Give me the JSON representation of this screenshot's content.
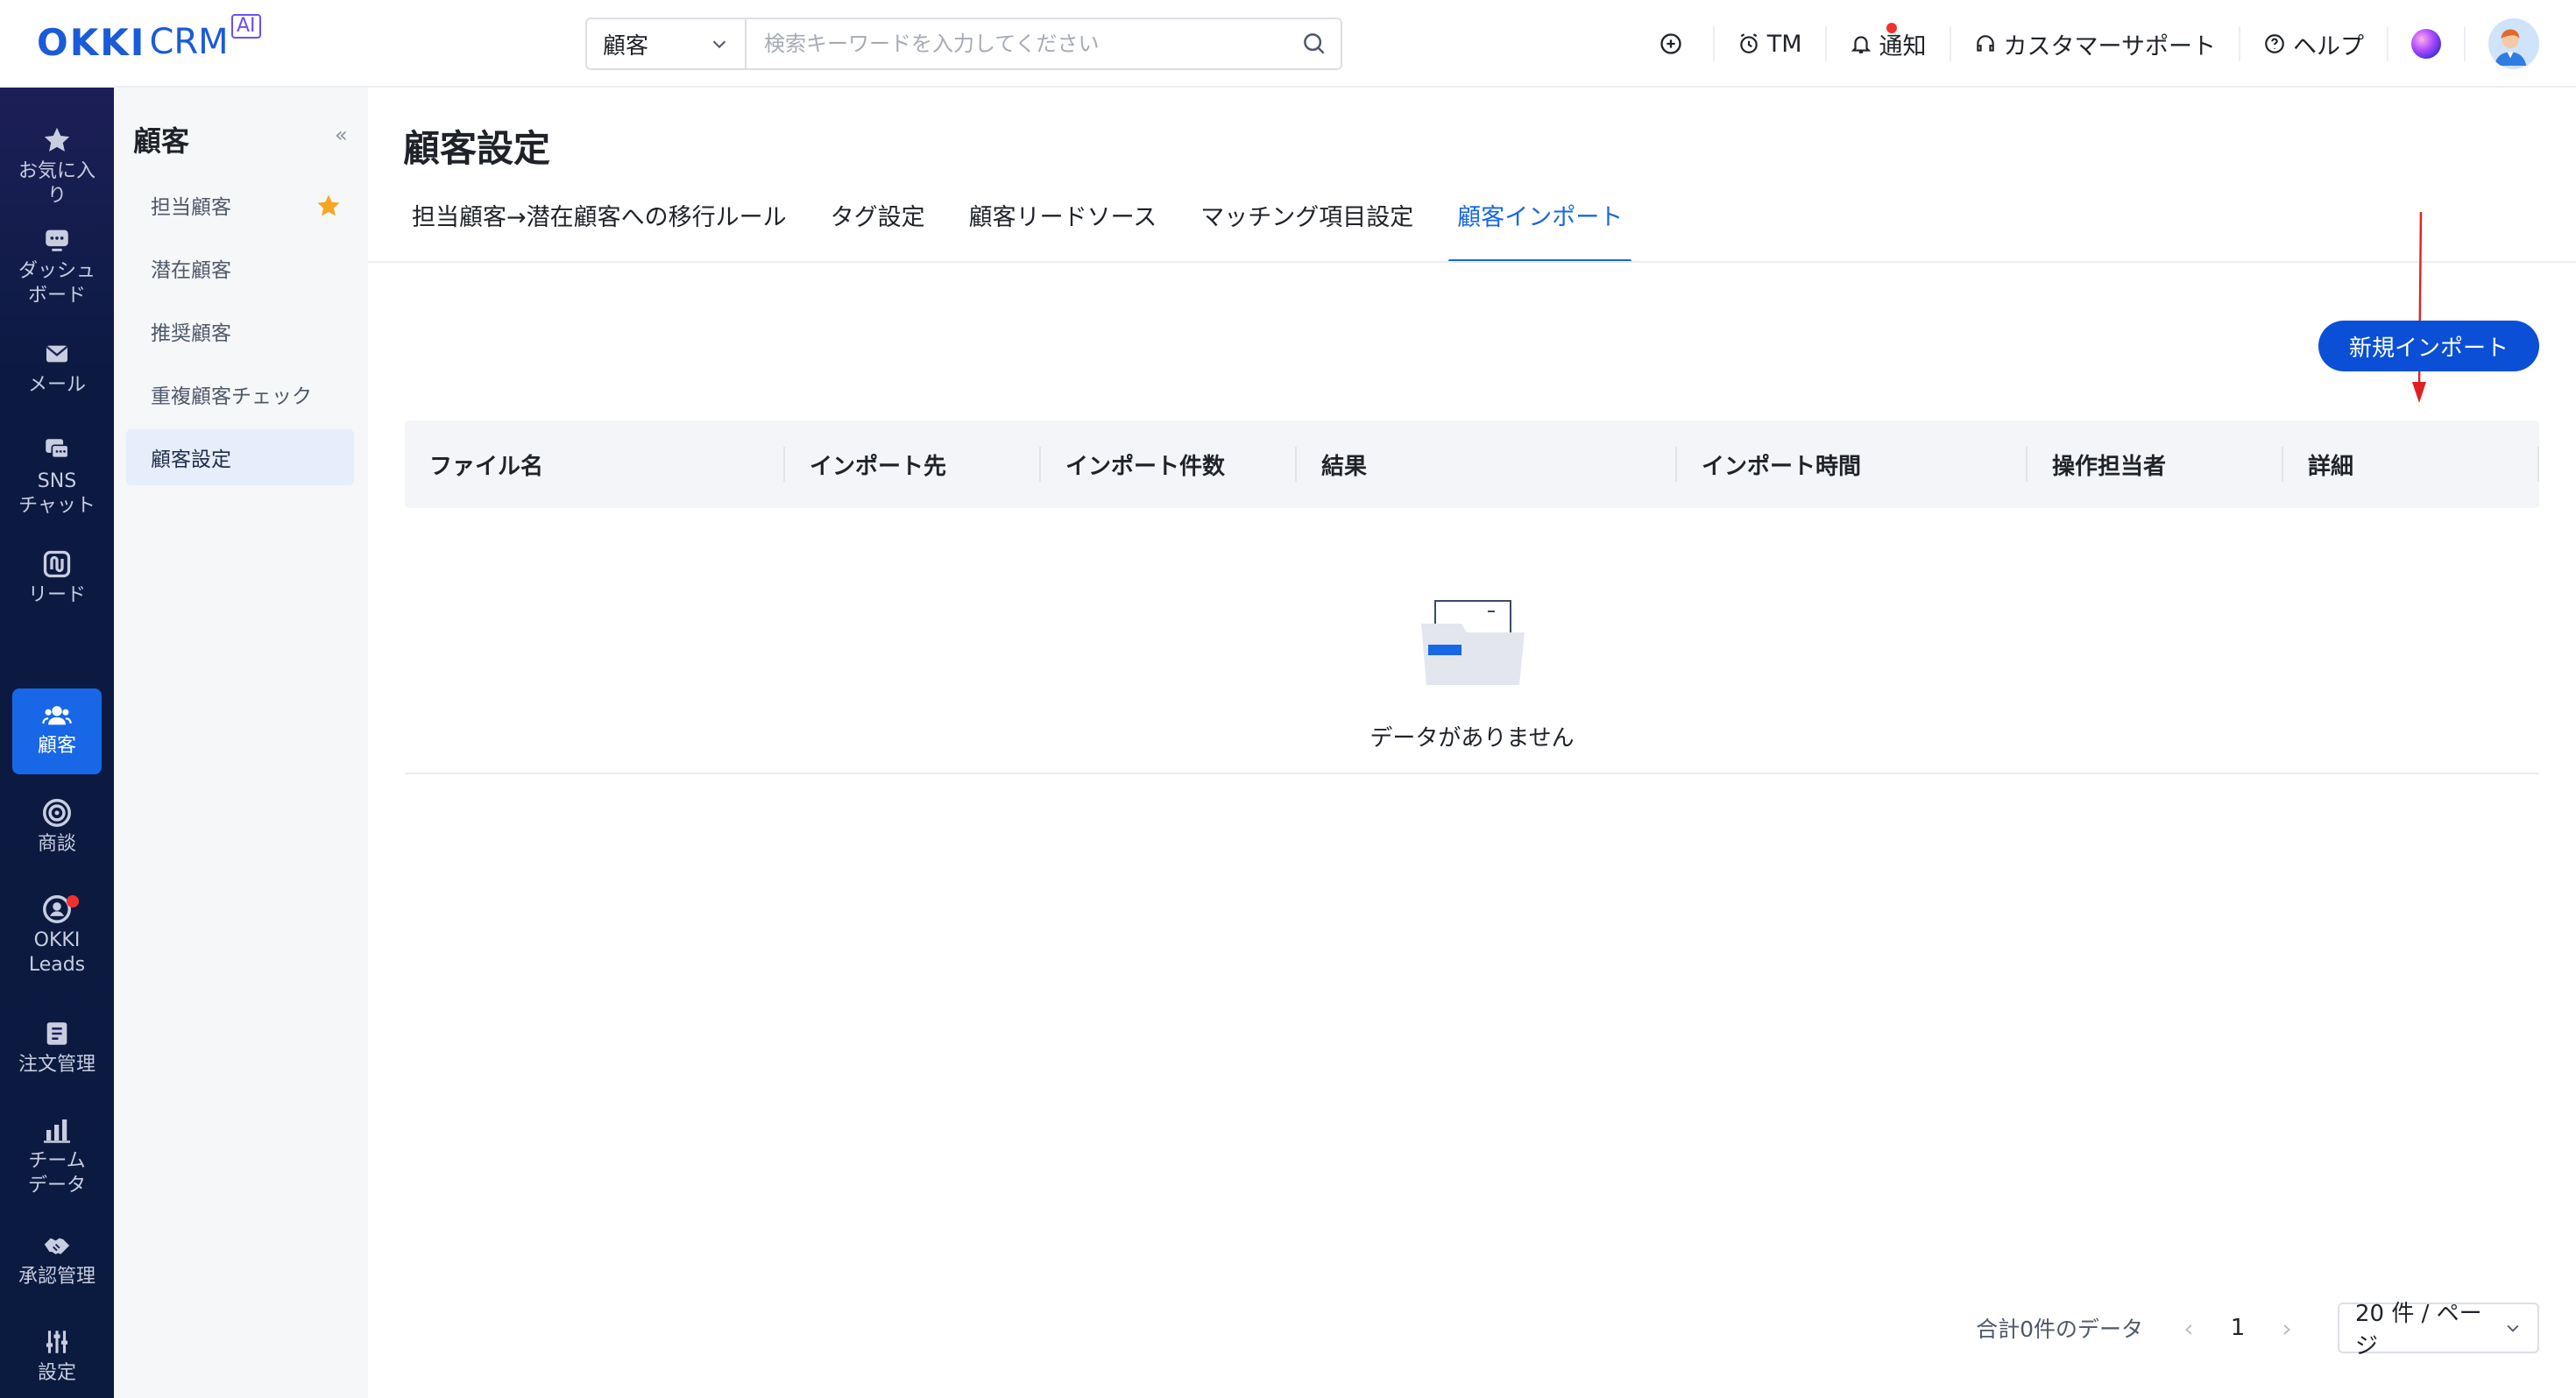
{
  "header": {
    "logo_main": "OKKI",
    "logo_sub": "CRM",
    "logo_badge": "AI",
    "search_scope": "顧客",
    "search_placeholder": "検索キーワードを入力してください",
    "actions": {
      "add_icon": "plus-circle-icon",
      "tm_label": "TM",
      "notify_label": "通知",
      "support_label": "カスタマーサポート",
      "help_label": "ヘルプ"
    }
  },
  "leftnav": [
    {
      "label": "お気に入\nり",
      "icon": "star-icon"
    },
    {
      "label": "ダッシュ\nボード",
      "icon": "dashboard-icon"
    },
    {
      "label": "メール",
      "icon": "mail-icon"
    },
    {
      "label": "SNS\nチャット",
      "icon": "chat-icon"
    },
    {
      "label": "リード",
      "icon": "lead-icon"
    },
    {
      "label": "顧客",
      "icon": "customer-icon",
      "active": true
    },
    {
      "label": "商談",
      "icon": "target-icon"
    },
    {
      "label": "OKKI\nLeads",
      "icon": "okki-leads-icon"
    },
    {
      "label": "注文管理",
      "icon": "order-icon"
    },
    {
      "label": "チーム\nデータ",
      "icon": "bar-chart-icon"
    },
    {
      "label": "承認管理",
      "icon": "handshake-icon"
    },
    {
      "label": "設定",
      "icon": "settings-icon"
    }
  ],
  "subnav": {
    "title": "顧客",
    "collapse": "«",
    "items": [
      {
        "label": "担当顧客",
        "starred": true
      },
      {
        "label": "潜在顧客"
      },
      {
        "label": "推奨顧客"
      },
      {
        "label": "重複顧客チェック"
      },
      {
        "label": "顧客設定",
        "active": true
      }
    ]
  },
  "main": {
    "title": "顧客設定",
    "tabs": [
      {
        "label": "担当顧客→潜在顧客への移行ルール"
      },
      {
        "label": "タグ設定"
      },
      {
        "label": "顧客リードソース"
      },
      {
        "label": "マッチング項目設定"
      },
      {
        "label": "顧客インポート",
        "active": true
      }
    ],
    "new_import_label": "新規インポート",
    "table": {
      "columns": [
        "ファイル名",
        "インポート先",
        "インポート件数",
        "結果",
        "インポート時間",
        "操作担当者",
        "詳細"
      ]
    },
    "empty_text": "データがありません",
    "pager": {
      "total": "合計0件のデータ",
      "prev": "‹",
      "page": "1",
      "next": "›",
      "page_size": "20 件 / ページ"
    }
  },
  "colors": {
    "accent": "#1767e6",
    "button": "#0a4fd6",
    "nav_bg": "#0b1a3f",
    "badge_red": "#f23030",
    "star": "#f5a623"
  }
}
